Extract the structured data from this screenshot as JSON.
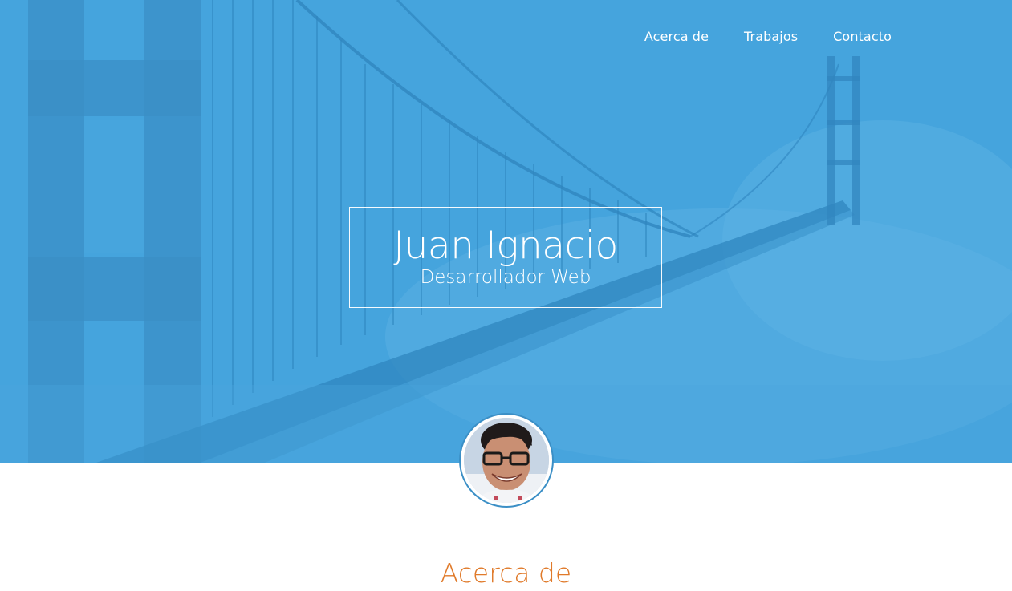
{
  "nav": {
    "items": [
      {
        "label": "Acerca de"
      },
      {
        "label": "Trabajos"
      },
      {
        "label": "Contacto"
      }
    ]
  },
  "hero": {
    "name": "Juan Ignacio",
    "role": "Desarrollador Web"
  },
  "about": {
    "title": "Acerca de"
  },
  "colors": {
    "hero_blue": "#4aa6de",
    "accent_orange": "#e07a2a",
    "white": "#ffffff"
  }
}
